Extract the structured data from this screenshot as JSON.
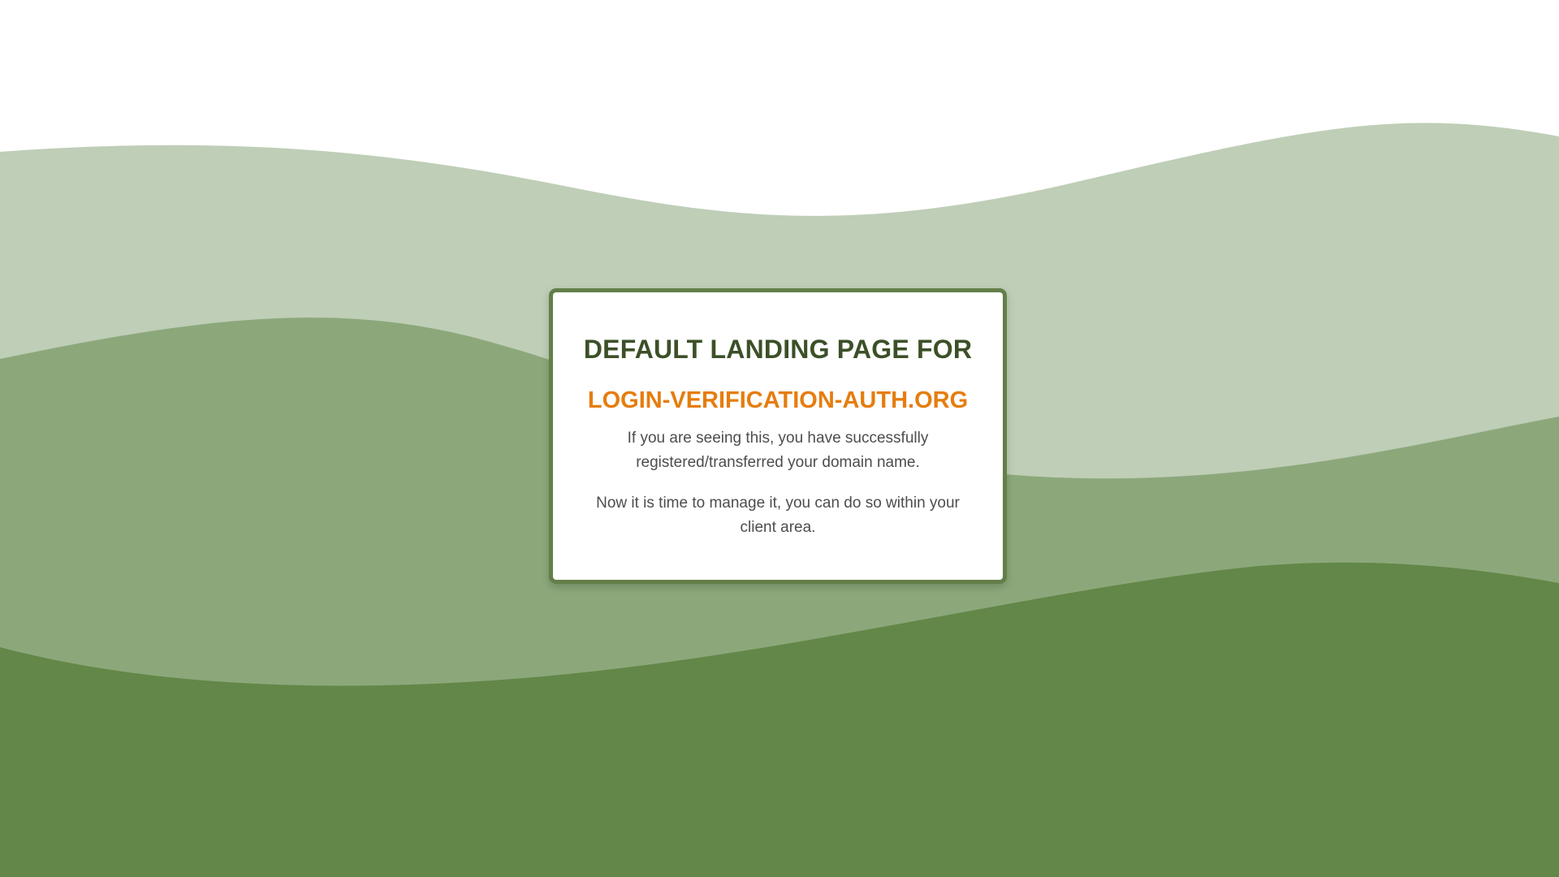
{
  "page": {
    "heading": "DEFAULT LANDING PAGE FOR",
    "domain": "LOGIN-VERIFICATION-AUTH.ORG",
    "message_1": "If you are seeing this, you have successfully registered/transferred your domain name.",
    "message_2": "Now it is time to manage it, you can do so within your client area."
  },
  "colors": {
    "background": "#ffffff",
    "wave_light": "#bfceb7",
    "wave_mid": "#8ca87b",
    "wave_dark": "#628748",
    "card_border": "#637f48",
    "heading": "#3c5028",
    "domain": "#e57d0e",
    "body_text": "#4d4d4d"
  }
}
